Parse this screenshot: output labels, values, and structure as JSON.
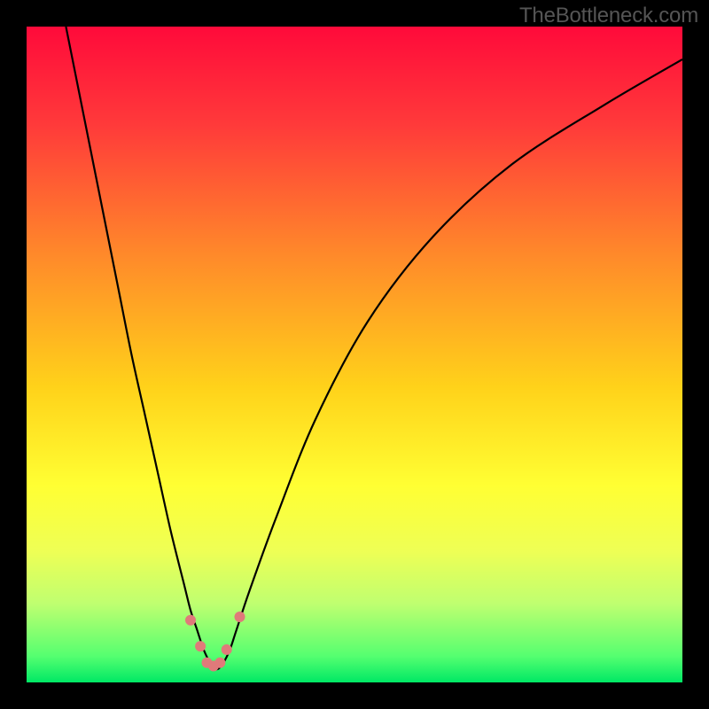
{
  "watermark": "TheBottleneck.com",
  "chart_data": {
    "type": "line",
    "title": "",
    "xlabel": "",
    "ylabel": "",
    "xlim": [
      0,
      100
    ],
    "ylim": [
      0,
      100
    ],
    "background_gradient": {
      "stops": [
        {
          "offset": 0.0,
          "color": "#ff0a3a"
        },
        {
          "offset": 0.15,
          "color": "#ff3a3a"
        },
        {
          "offset": 0.35,
          "color": "#ff8a2a"
        },
        {
          "offset": 0.55,
          "color": "#ffd21a"
        },
        {
          "offset": 0.7,
          "color": "#ffff33"
        },
        {
          "offset": 0.8,
          "color": "#eeff55"
        },
        {
          "offset": 0.88,
          "color": "#bfff70"
        },
        {
          "offset": 0.96,
          "color": "#55ff70"
        },
        {
          "offset": 1.0,
          "color": "#00e865"
        }
      ]
    },
    "series": [
      {
        "name": "bottleneck-curve",
        "color": "#000000",
        "x": [
          6,
          8,
          10,
          12,
          14,
          16,
          18,
          20,
          22,
          24,
          25,
          26,
          27,
          28,
          29,
          30,
          31,
          32,
          34,
          38,
          44,
          52,
          62,
          74,
          88,
          100
        ],
        "y": [
          100,
          90,
          80,
          70,
          60,
          50,
          41,
          32,
          23,
          15,
          11,
          8,
          5,
          3,
          2,
          3,
          5,
          8,
          14,
          25,
          40,
          55,
          68,
          79,
          88,
          95
        ]
      }
    ],
    "markers": {
      "name": "highlight-points",
      "color": "#e07a7a",
      "radius": 6,
      "points": [
        {
          "x": 25.0,
          "y": 9.5
        },
        {
          "x": 26.5,
          "y": 5.5
        },
        {
          "x": 27.5,
          "y": 3.0
        },
        {
          "x": 28.5,
          "y": 2.5
        },
        {
          "x": 29.5,
          "y": 3.0
        },
        {
          "x": 30.5,
          "y": 5.0
        },
        {
          "x": 32.5,
          "y": 10.0
        }
      ]
    }
  }
}
